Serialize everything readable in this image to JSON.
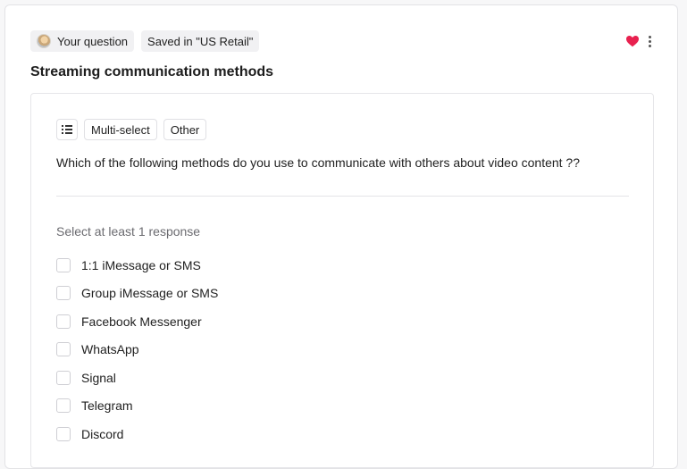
{
  "header": {
    "your_question_label": "Your question",
    "saved_label": "Saved in \"US Retail\"",
    "title": "Streaming communication methods",
    "heart_color": "#e8214f"
  },
  "question_card": {
    "type_icon": "list-icon",
    "tags": [
      "Multi-select",
      "Other"
    ],
    "question_text": "Which of the following methods do you use to communicate with others about video content ??",
    "hint": "Select at least 1 response",
    "options": [
      "1:1 iMessage or SMS",
      "Group iMessage or SMS",
      "Facebook Messenger",
      "WhatsApp",
      "Signal",
      "Telegram",
      "Discord"
    ]
  }
}
